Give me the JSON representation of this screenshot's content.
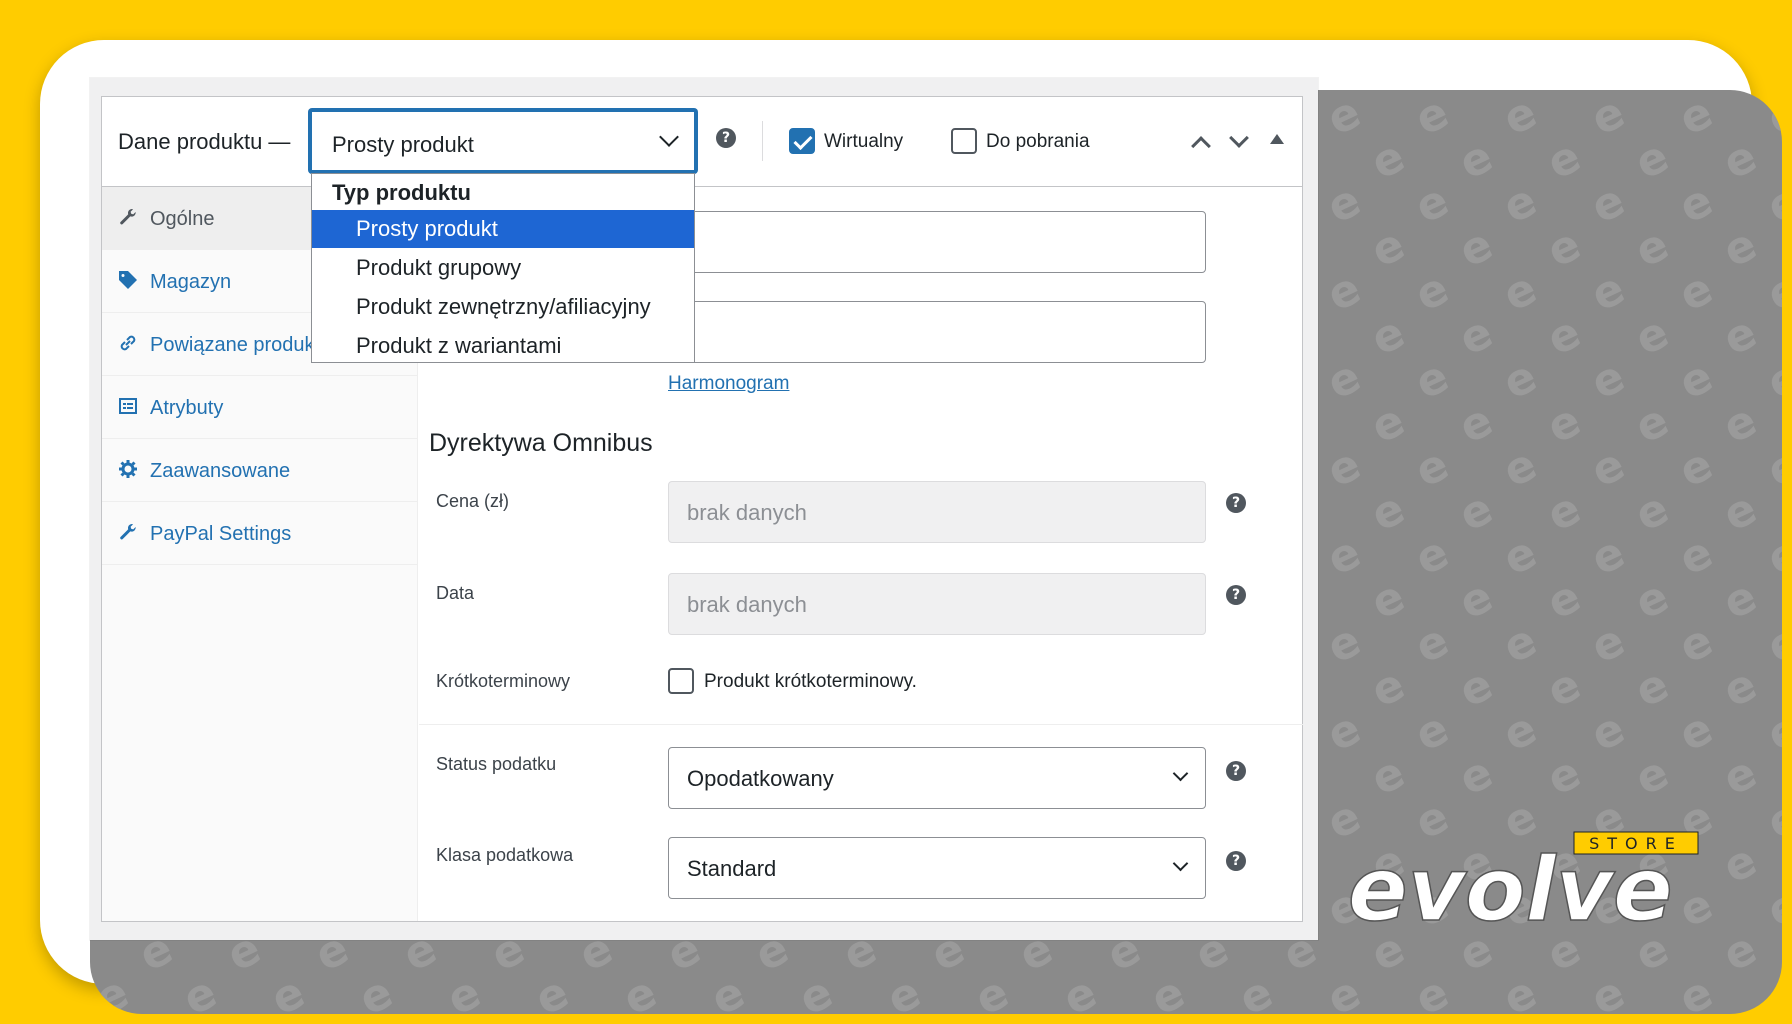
{
  "header": {
    "title": "Dane produktu —",
    "product_type": "Prosty produkt",
    "virtual_label": "Wirtualny",
    "virtual_checked": true,
    "downloadable_label": "Do pobrania",
    "downloadable_checked": false
  },
  "dropdown": {
    "group_label": "Typ produktu",
    "options": [
      {
        "label": "Prosty produkt",
        "selected": true
      },
      {
        "label": "Produkt grupowy",
        "selected": false
      },
      {
        "label": "Produkt zewnętrzny/afiliacyjny",
        "selected": false
      },
      {
        "label": "Produkt z wariantami",
        "selected": false
      }
    ]
  },
  "tabs": [
    {
      "label": "Ogólne",
      "icon": "wrench-icon",
      "active": true
    },
    {
      "label": "Magazyn",
      "icon": "tag-icon",
      "active": false
    },
    {
      "label": "Powiązane produk",
      "icon": "link-icon",
      "active": false
    },
    {
      "label": "Atrybuty",
      "icon": "list-icon",
      "active": false
    },
    {
      "label": "Zaawansowane",
      "icon": "gear-icon",
      "active": false
    },
    {
      "label": "PayPal Settings",
      "icon": "wrench-icon",
      "active": false
    }
  ],
  "general": {
    "schedule_link": "Harmonogram",
    "omnibus_title": "Dyrektywa Omnibus",
    "price_label": "Cena (zł)",
    "price_value": "brak danych",
    "date_label": "Data",
    "date_value": "brak danych",
    "short_term_label": "Krótkoterminowy",
    "short_term_checkbox_label": "Produkt krótkoterminowy.",
    "tax_status_label": "Status podatku",
    "tax_status_value": "Opodatkowany",
    "tax_class_label": "Klasa podatkowa",
    "tax_class_value": "Standard"
  },
  "brand": {
    "logo_text": "evolve",
    "logo_sub": "STORE",
    "accent": "#FFCC00"
  }
}
